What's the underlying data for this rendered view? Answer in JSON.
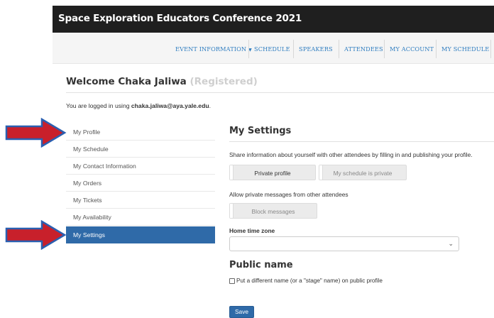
{
  "app": {
    "title": "Space Exploration Educators Conference 2021"
  },
  "nav": {
    "items": [
      {
        "label": "EVENT INFORMATION",
        "caret": "▼"
      },
      {
        "label": "SCHEDULE"
      },
      {
        "label": "SPEAKERS"
      },
      {
        "label": "ATTENDEES"
      },
      {
        "label": "MY ACCOUNT"
      },
      {
        "label": "MY SCHEDULE"
      }
    ]
  },
  "welcome": {
    "greeting": "Welcome Chaka Jaliwa",
    "status": "(Registered)"
  },
  "login": {
    "prefix": "You are logged in using",
    "email": "chaka.jaliwa@aya.yale.edu",
    "suffix": "."
  },
  "sidebar": {
    "items": [
      {
        "label": "My Profile"
      },
      {
        "label": "My Schedule"
      },
      {
        "label": "My Contact Information"
      },
      {
        "label": "My Orders"
      },
      {
        "label": "My Tickets"
      },
      {
        "label": "My Availability"
      },
      {
        "label": "My Settings"
      }
    ],
    "active_index": 6
  },
  "annotations": {
    "arrow_color": "#c8202b",
    "arrow_outline": "#2a5fb0"
  },
  "settings": {
    "title": "My Settings",
    "share_text": "Share information about yourself with other attendees by filling in and publishing your profile.",
    "private_profile_label": "Private profile",
    "schedule_private_label": "My schedule is private",
    "pm_text": "Allow private messages from other attendees",
    "block_messages_label": "Block messages",
    "tz_label": "Home time zone",
    "tz_value": ""
  },
  "public_name": {
    "title": "Public name",
    "checkbox_label": "Put a different name (or a \"stage\" name) on public profile",
    "checked": false
  },
  "actions": {
    "save_label": "Save"
  },
  "colors": {
    "header_bg": "#1f1f1f",
    "link": "#2f7dc0",
    "active": "#2f6aa8"
  }
}
